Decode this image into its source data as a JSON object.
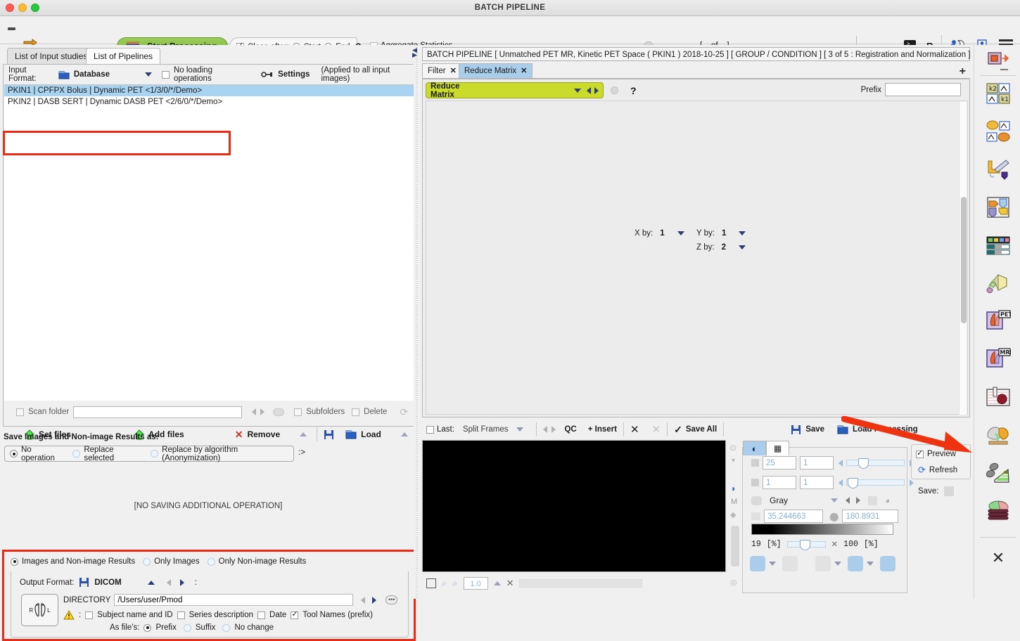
{
  "window": {
    "title": "BATCH PIPELINE"
  },
  "toolbar": {
    "start_processing": "Start Processing",
    "close_after": "Close after:",
    "start_label": "Start",
    "end_label": "End",
    "help": "?",
    "aggregate_statistics": "Aggregate Statistics",
    "aggregate_arrow": ">",
    "counter": "[ _ of _ ]",
    "next_arrow": ">",
    "terminal_icon_label": ">_",
    "r_label": "R",
    "icons": [
      "expand-folder-icon",
      "terminal-icon",
      "r-console-icon",
      "plugin-icon",
      "screenshot-icon",
      "menu-icon"
    ]
  },
  "left": {
    "tabs": [
      {
        "label": "List of Input studies",
        "selected": true
      },
      {
        "label": "List of Pipelines",
        "selected": false
      }
    ],
    "input_format": {
      "label": "Input Format:",
      "value": "Database",
      "no_loading_operations": "No loading operations",
      "settings": "Settings",
      "applied_note": "(Applied to all input images)"
    },
    "studies": [
      {
        "text": "PKIN1 | CPFPX Bolus | Dynamic PET <1/3/0/*/Demo>",
        "selected": true
      },
      {
        "text": "PKIN2 | DASB SERT | Dynamic DASB PET <2/6/0/*/Demo>",
        "selected": false
      }
    ],
    "scan": {
      "scan_folder": "Scan folder",
      "path_value": "",
      "path_placeholder": "",
      "subfolders": "Subfolders",
      "delete": "Delete"
    },
    "buttons": {
      "set_files": "Set files",
      "add_files": "Add files",
      "remove": "Remove",
      "load": "Load"
    },
    "save_section": {
      "title": "Save Images and Non-image Results  as:",
      "options": [
        {
          "label": "No operation",
          "selected": true
        },
        {
          "label": "Replace selected",
          "selected": false
        },
        {
          "label": "Replace by algorithm (Anonymization)",
          "selected": false
        }
      ],
      "arrow": ":>",
      "status": "[NO SAVING ADDITIONAL OPERATION]"
    },
    "output_section": {
      "result_options": [
        {
          "label": "Images and Non-image Results",
          "selected": true
        },
        {
          "label": "Only Images",
          "selected": false
        },
        {
          "label": "Only Non-image Results",
          "selected": false
        }
      ],
      "output_format_label": "Output Format:",
      "output_format_value": "DICOM",
      "output_format_colon": ":",
      "directory_label": "DIRECTORY",
      "directory_value": "/Users/user/Pmod",
      "orientation_icon_left": "R",
      "orientation_icon_right": "L",
      "name_colon": ":",
      "name_options": [
        {
          "label": "Subject name and ID",
          "checked": false
        },
        {
          "label": "Series description",
          "checked": false
        },
        {
          "label": "Date",
          "checked": false
        },
        {
          "label": "Tool Names (prefix)",
          "checked": true
        }
      ],
      "as_files_label": "As file's:",
      "as_files_options": [
        {
          "label": "Prefix",
          "selected": true
        },
        {
          "label": "Suffix",
          "selected": false
        },
        {
          "label": "No change",
          "selected": false
        }
      ]
    }
  },
  "right": {
    "header": "BATCH PIPELINE   [ Unmatched PET MR, Kinetic PET Space ( PKIN1 ) 2018-10-25 ]   [ GROUP / CONDITION ]   [ 3 of 5 : Registration and Normalization ]",
    "tabs": [
      {
        "label": "Filter",
        "close": "✕",
        "selected": false
      },
      {
        "label": "Reduce Matrix",
        "close": "✕",
        "selected": true
      }
    ],
    "add_tab": "+",
    "tool": {
      "name": "Reduce Matrix",
      "help": "?",
      "prefix_label": "Prefix",
      "prefix_value": "",
      "params": [
        {
          "label": "X by:",
          "value": "1"
        },
        {
          "label": "Y by:",
          "value": "1"
        },
        {
          "label": "Z by:",
          "value": "2"
        }
      ]
    },
    "midbar": {
      "last": "Last:",
      "split_frames": "Split Frames",
      "qc": "QC",
      "insert": "+ Insert",
      "save_all": "Save All",
      "save": "Save",
      "load_processing": "Load Processing"
    },
    "viewer": {
      "zoom": "1.0",
      "controls": {
        "slice_value": "25",
        "slice_step": "1",
        "frame_value": "1",
        "frame_step": "1",
        "colortable": "Gray",
        "min_value": "35.244663",
        "max_value": "180.8931",
        "low_pct": "19",
        "low_unit": "[%]",
        "high_pct": "100",
        "high_unit": "[%]"
      },
      "preview_label": "Preview",
      "preview_checked": true,
      "refresh_label": "Refresh",
      "save_label": "Save:"
    }
  },
  "rail": {
    "items": [
      "pipeline-node-icon",
      "kinetic-modeling-k2-k1-icon",
      "kinetic-curves-icon",
      "fusion-tool-icon",
      "segmentation-quad-icon",
      "table-data-icon",
      "3d-rendering-icon",
      "pet-viewer-icon",
      "mri-viewer-icon",
      "cardiac-tool-icon",
      "brain-tool-icon",
      "statistics-tool-icon",
      "slices-stack-icon",
      "close-icon"
    ]
  },
  "colors": {
    "accent_green": "#8dbf4c",
    "tool_yellow": "#cadb2b",
    "tab_blue": "#a9cdeb",
    "selection_blue": "#a8d4f2",
    "annotation_red": "#ec2b17"
  }
}
